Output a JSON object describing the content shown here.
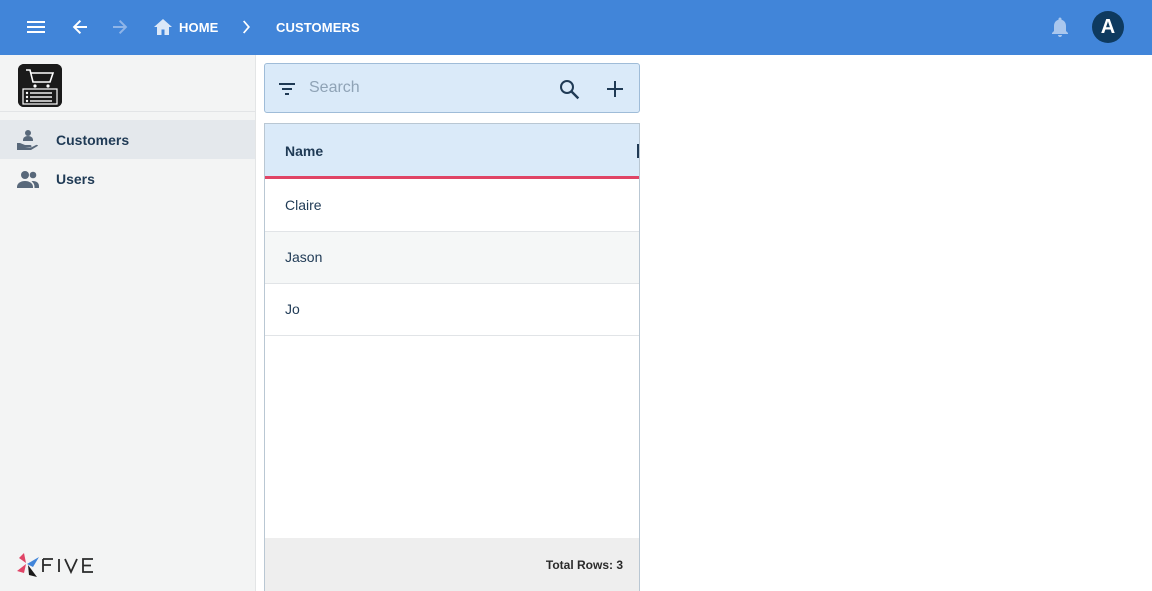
{
  "topbar": {
    "breadcrumb": {
      "home": "HOME",
      "current": "CUSTOMERS"
    },
    "avatar_letter": "A",
    "colors": {
      "background": "#4185d9",
      "avatar": "#0e3a5f"
    }
  },
  "sidebar": {
    "items": [
      {
        "label": "Customers",
        "icon": "customer-hand-icon",
        "active": true
      },
      {
        "label": "Users",
        "icon": "users-icon",
        "active": false
      }
    ],
    "footer_logo_text": "FIVE"
  },
  "search": {
    "placeholder": "Search",
    "value": ""
  },
  "grid": {
    "columns": [
      "Name"
    ],
    "rows": [
      {
        "name": "Claire"
      },
      {
        "name": "Jason"
      },
      {
        "name": "Jo"
      }
    ],
    "footer": "Total Rows: 3",
    "colors": {
      "header_bg": "#daeaf9",
      "header_underline": "#e04466"
    }
  }
}
